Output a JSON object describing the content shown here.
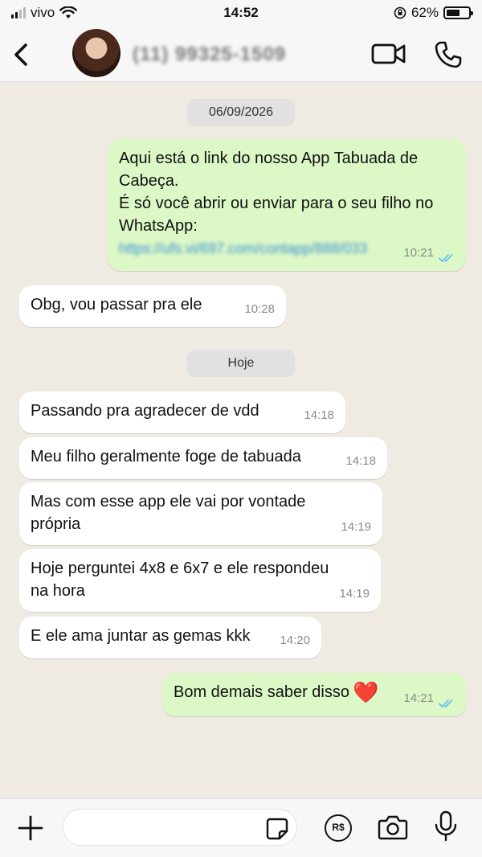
{
  "status_bar": {
    "carrier": "vivo",
    "time": "14:52",
    "battery_percent": "62%",
    "battery_level": 0.62
  },
  "header": {
    "contact_name": "(11) 99325-1509",
    "icons": [
      "back-icon",
      "video-call-icon",
      "phone-call-icon"
    ]
  },
  "chat": {
    "date_chips": [
      {
        "label": "06/09/2026"
      },
      {
        "label": "Hoje"
      }
    ],
    "messages": [
      {
        "direction": "out",
        "lines": [
          "Aqui está o link do nosso App Tabuada de",
          "Cabeça.",
          "É só você abrir ou enviar para o seu filho no",
          "WhatsApp:"
        ],
        "link": "https://ufs.vi/697.com/contapp/888/033",
        "time": "10:21",
        "read": true
      },
      {
        "direction": "in",
        "text": "Obg, vou passar pra ele",
        "time": "10:28"
      },
      {
        "direction": "in",
        "text": "Passando pra agradecer de vdd",
        "time": "14:18"
      },
      {
        "direction": "in",
        "text": "Meu filho geralmente foge de tabuada",
        "time": "14:18"
      },
      {
        "direction": "in",
        "lines": [
          "Mas com esse app ele vai por vontade",
          "própria"
        ],
        "time": "14:19"
      },
      {
        "direction": "in",
        "lines": [
          "Hoje perguntei 4x8 e 6x7 e ele respondeu",
          "na hora"
        ],
        "time": "14:19"
      },
      {
        "direction": "in",
        "text": "E ele ama juntar as gemas kkk",
        "time": "14:20"
      },
      {
        "direction": "out",
        "text": "Bom demais saber disso",
        "emoji": "❤️",
        "time": "14:21",
        "read": true
      }
    ]
  },
  "input_bar": {
    "placeholder": "",
    "pix_label": "R$",
    "icons": [
      "plus-icon",
      "sticker-icon",
      "pix-icon",
      "camera-icon",
      "microphone-icon"
    ]
  },
  "colors": {
    "background": "#efeae2",
    "outgoing_bubble": "#dcf8c6",
    "incoming_bubble": "#ffffff",
    "read_ticks": "#53bdeb"
  }
}
